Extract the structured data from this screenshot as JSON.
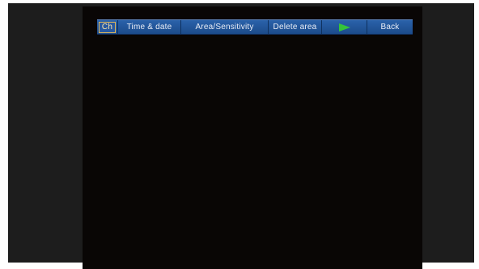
{
  "menu": {
    "items": [
      {
        "label": "Ch"
      },
      {
        "label": "Time & date"
      },
      {
        "label": "Area/Sensitivity"
      },
      {
        "label": "Delete area"
      },
      {
        "icon": "play-arrow-icon",
        "color": "#35c43a"
      },
      {
        "label": "Back"
      }
    ]
  },
  "colors": {
    "menu_bar": "#1e4f90",
    "screen": "#090605",
    "frame": "#1d1d1d",
    "highlight_border": "#e2b85a"
  }
}
